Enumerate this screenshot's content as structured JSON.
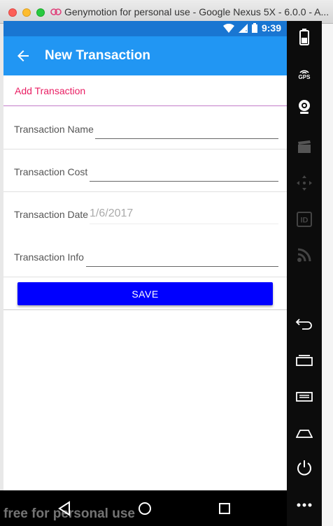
{
  "window": {
    "title": "Genymotion for personal use - Google Nexus 5X - 6.0.0 - A..."
  },
  "status_bar": {
    "time": "9:39"
  },
  "app_bar": {
    "title": "New Transaction"
  },
  "tab": {
    "label": "Add Transaction"
  },
  "form": {
    "name_label": "Transaction Name",
    "name_value": "",
    "cost_label": "Transaction Cost",
    "cost_value": "",
    "date_label": "Transaction Date",
    "date_value": "1/6/2017",
    "info_label": "Transaction Info",
    "info_value": "",
    "save_label": "SAVE"
  },
  "sidebar": {
    "gps_label": "GPS",
    "id_label": "ID"
  },
  "watermark": "free for personal use",
  "colors": {
    "status_bar": "#1976d2",
    "app_bar": "#2196f3",
    "tab_accent": "#e91e63",
    "save_button": "#0000ff"
  },
  "icons": {
    "back": "arrow-left-icon",
    "battery": "battery-icon",
    "gps": "gps-icon",
    "camera": "webcam-icon",
    "record": "clapperboard-icon",
    "dpad": "dpad-icon",
    "id": "id-icon",
    "network": "signal-icon",
    "nav_back": "triangle-back-icon",
    "nav_home": "circle-home-icon",
    "nav_recents": "square-recents-icon"
  }
}
